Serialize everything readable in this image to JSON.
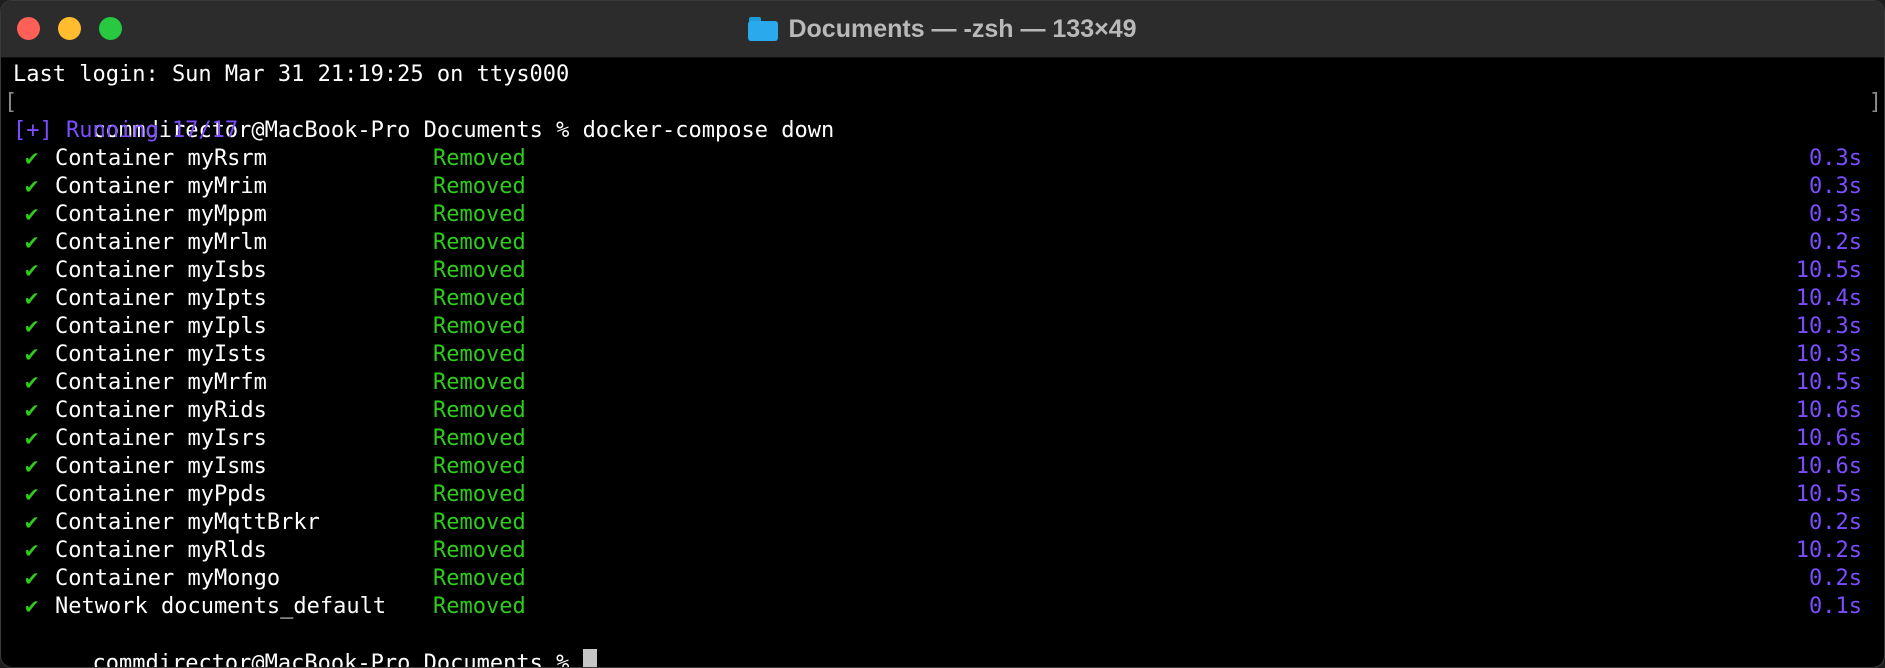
{
  "window": {
    "title": "Documents — -zsh — 133×49"
  },
  "terminal": {
    "last_login": "Last login: Sun Mar 31 21:19:25 on ttys000",
    "prompt": "commdirector@MacBook-Pro Documents % ",
    "command": "docker-compose down",
    "running": "[+] Running 17/17",
    "check_glyph": "✔",
    "rows": [
      {
        "name": "Container myRsrm",
        "status": "Removed",
        "duration": "0.3s"
      },
      {
        "name": "Container myMrim",
        "status": "Removed",
        "duration": "0.3s"
      },
      {
        "name": "Container myMppm",
        "status": "Removed",
        "duration": "0.3s"
      },
      {
        "name": "Container myMrlm",
        "status": "Removed",
        "duration": "0.2s"
      },
      {
        "name": "Container myIsbs",
        "status": "Removed",
        "duration": "10.5s"
      },
      {
        "name": "Container myIpts",
        "status": "Removed",
        "duration": "10.4s"
      },
      {
        "name": "Container myIpls",
        "status": "Removed",
        "duration": "10.3s"
      },
      {
        "name": "Container myIsts",
        "status": "Removed",
        "duration": "10.3s"
      },
      {
        "name": "Container myMrfm",
        "status": "Removed",
        "duration": "10.5s"
      },
      {
        "name": "Container myRids",
        "status": "Removed",
        "duration": "10.6s"
      },
      {
        "name": "Container myIsrs",
        "status": "Removed",
        "duration": "10.6s"
      },
      {
        "name": "Container myIsms",
        "status": "Removed",
        "duration": "10.6s"
      },
      {
        "name": "Container myPpds",
        "status": "Removed",
        "duration": "10.5s"
      },
      {
        "name": "Container myMqttBrkr",
        "status": "Removed",
        "duration": "0.2s"
      },
      {
        "name": "Container myRlds",
        "status": "Removed",
        "duration": "10.2s"
      },
      {
        "name": "Container myMongo",
        "status": "Removed",
        "duration": "0.2s"
      },
      {
        "name": "Network documents_default",
        "status": "Removed",
        "duration": "0.1s"
      }
    ],
    "final_prompt": "commdirector@MacBook-Pro Documents % "
  },
  "colors": {
    "background": "#000000",
    "text": "#ffffff",
    "success": "#2ecc1a",
    "accent_purple": "#7b4dff"
  }
}
